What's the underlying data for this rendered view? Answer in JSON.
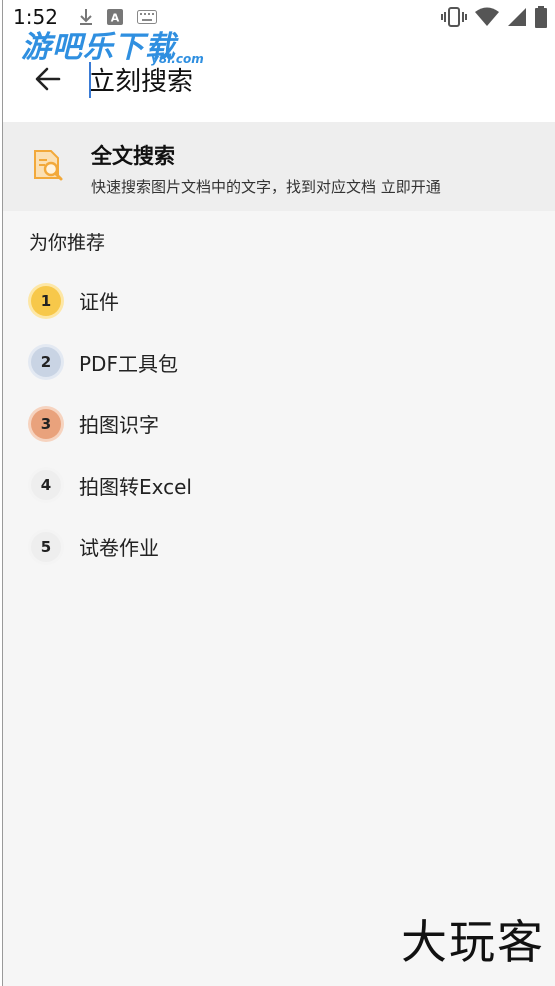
{
  "status_bar": {
    "time": "1:52",
    "icons": [
      "download-icon",
      "a-badge-icon",
      "keyboard-icon",
      "vibrate-icon",
      "wifi-icon",
      "signal-icon",
      "battery-icon"
    ]
  },
  "watermark_top": {
    "text": "游吧乐下载",
    "sub": "y8l.com"
  },
  "header": {
    "back_icon": "arrow-left-icon",
    "search_value": "立刻搜索"
  },
  "full_text_search": {
    "icon": "document-search-icon",
    "title": "全文搜索",
    "description": "快速搜索图片文档中的文字，找到对应文档 立即开通",
    "accent_color": "#f2a93b"
  },
  "recommendations": {
    "heading": "为你推荐",
    "items": [
      {
        "rank": "1",
        "label": "证件",
        "badge_color": "#f7c84a",
        "ring_color": "#fde7a6"
      },
      {
        "rank": "2",
        "label": "PDF工具包",
        "badge_color": "#c9d4e4",
        "ring_color": "#e3e9f2"
      },
      {
        "rank": "3",
        "label": "拍图识字",
        "badge_color": "#e9a27c",
        "ring_color": "#f6d3bf"
      },
      {
        "rank": "4",
        "label": "拍图转Excel",
        "badge_color": "#eeeeee",
        "ring_color": "#f4f4f4"
      },
      {
        "rank": "5",
        "label": "试卷作业",
        "badge_color": "#eeeeee",
        "ring_color": "#f4f4f4"
      }
    ]
  },
  "watermark_bottom": {
    "text": "大玩客"
  }
}
